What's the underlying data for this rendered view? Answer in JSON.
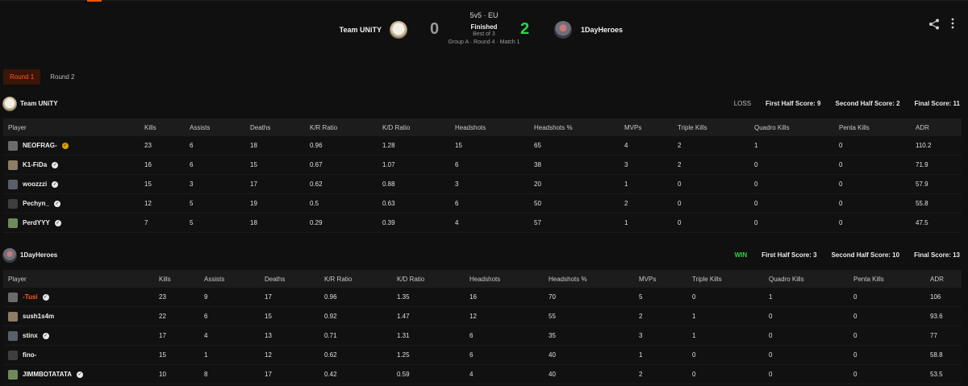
{
  "match": {
    "mode": "5v5 · EU",
    "status": "Finished",
    "best_of": "Best of 3",
    "group": "Group A · Round 4 · Match 1",
    "team1": {
      "name": "Team UNiTY",
      "score": "0"
    },
    "team2": {
      "name": "1DayHeroes",
      "score": "2"
    }
  },
  "tabs": [
    {
      "label": "Round 1",
      "active": true
    },
    {
      "label": "Round 2",
      "active": false
    }
  ],
  "columns": [
    "Player",
    "Kills",
    "Assists",
    "Deaths",
    "K/R Ratio",
    "K/D Ratio",
    "Headshots",
    "Headshots %",
    "MVPs",
    "Triple Kills",
    "Quadro Kills",
    "Penta Kills",
    "ADR"
  ],
  "teams": [
    {
      "name": "Team UNiTY",
      "result": "LOSS",
      "first_half": "First Half Score: 9",
      "second_half": "Second Half Score: 2",
      "final": "Final Score: 11",
      "players": [
        {
          "name": "NEOFRAG-",
          "badge": "gold",
          "stats": [
            "23",
            "6",
            "18",
            "0.96",
            "1.28",
            "15",
            "65",
            "4",
            "2",
            "1",
            "0",
            "110.2"
          ]
        },
        {
          "name": "K1-FiDa",
          "badge": "check",
          "stats": [
            "16",
            "6",
            "15",
            "0.67",
            "1.07",
            "6",
            "38",
            "3",
            "2",
            "0",
            "0",
            "71.9"
          ]
        },
        {
          "name": "woozzzi",
          "badge": "check",
          "stats": [
            "15",
            "3",
            "17",
            "0.62",
            "0.88",
            "3",
            "20",
            "1",
            "0",
            "0",
            "0",
            "57.9"
          ]
        },
        {
          "name": "Pechyn_",
          "badge": "check",
          "stats": [
            "12",
            "5",
            "19",
            "0.5",
            "0.63",
            "6",
            "50",
            "2",
            "0",
            "0",
            "0",
            "55.8"
          ]
        },
        {
          "name": "PerdYYY",
          "badge": "check",
          "stats": [
            "7",
            "5",
            "18",
            "0.29",
            "0.39",
            "4",
            "57",
            "1",
            "0",
            "0",
            "0",
            "47.5"
          ]
        }
      ]
    },
    {
      "name": "1DayHeroes",
      "result": "WIN",
      "first_half": "First Half Score: 3",
      "second_half": "Second Half Score: 10",
      "final": "Final Score: 13",
      "players": [
        {
          "name": "-Tusi",
          "badge": "check",
          "highlight": true,
          "stats": [
            "23",
            "9",
            "17",
            "0.96",
            "1.35",
            "16",
            "70",
            "5",
            "0",
            "1",
            "0",
            "106"
          ]
        },
        {
          "name": "sush1s4m",
          "badge": "none",
          "stats": [
            "22",
            "6",
            "15",
            "0.92",
            "1.47",
            "12",
            "55",
            "2",
            "1",
            "0",
            "0",
            "93.6"
          ]
        },
        {
          "name": "stinx",
          "badge": "check",
          "stats": [
            "17",
            "4",
            "13",
            "0.71",
            "1.31",
            "6",
            "35",
            "3",
            "1",
            "0",
            "0",
            "77"
          ]
        },
        {
          "name": "fino-",
          "badge": "none",
          "stats": [
            "15",
            "1",
            "12",
            "0.62",
            "1.25",
            "6",
            "40",
            "1",
            "0",
            "0",
            "0",
            "58.8"
          ]
        },
        {
          "name": "JIMMBOTATATA",
          "badge": "check",
          "stats": [
            "10",
            "8",
            "17",
            "0.42",
            "0.59",
            "4",
            "40",
            "2",
            "0",
            "0",
            "0",
            "53.5"
          ]
        }
      ]
    }
  ],
  "colors": {
    "accent": "#ff5a1f",
    "win": "#2fd44a",
    "background": "#101010",
    "header_row": "#1c1c1c"
  }
}
